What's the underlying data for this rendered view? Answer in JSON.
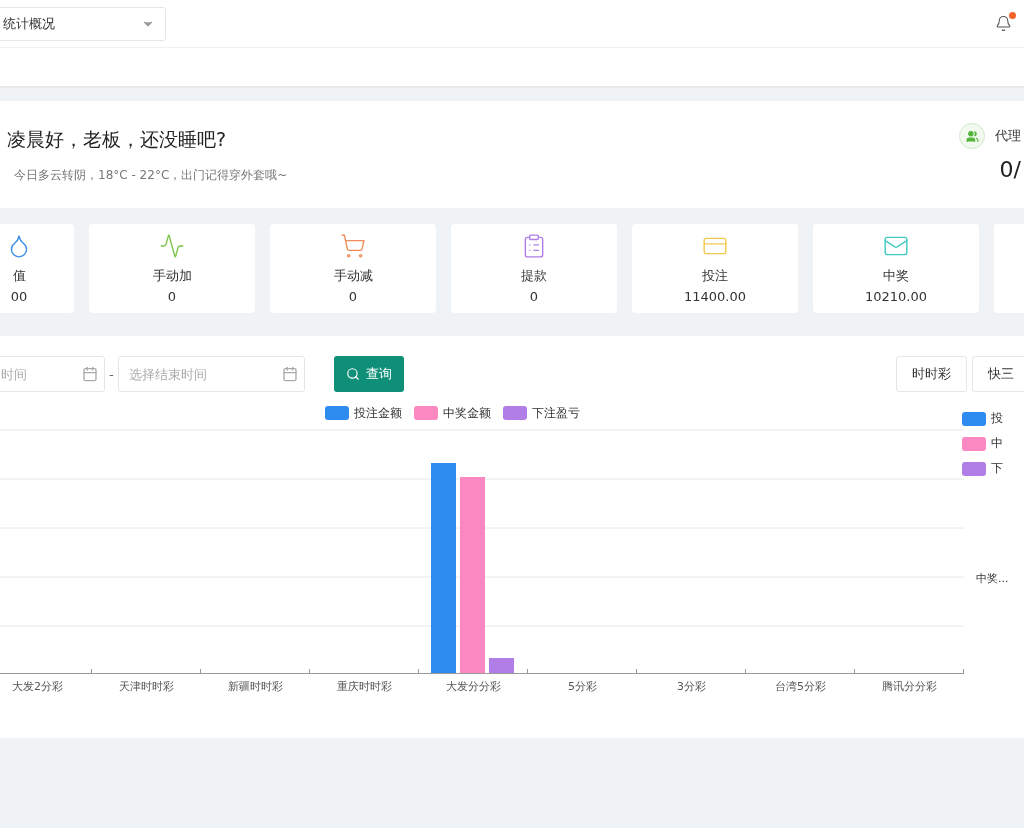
{
  "header": {
    "select": {
      "value": "统计概况"
    },
    "notification": {
      "unread": true
    }
  },
  "greeting": {
    "title": "凌晨好，老板，还没睡吧?",
    "subtitle": "今日多云转阴，18°C - 22°C，出门记得穿外套哦~",
    "agent_label": "代理",
    "agent_value": "0/"
  },
  "stats": [
    {
      "kind": "drop",
      "label": "值",
      "value": "00"
    },
    {
      "kind": "pulse",
      "label": "手动加",
      "value": "0"
    },
    {
      "kind": "cart",
      "label": "手动减",
      "value": "0"
    },
    {
      "kind": "clipboard",
      "label": "提款",
      "value": "0"
    },
    {
      "kind": "card",
      "label": "投注",
      "value": "11400.00"
    },
    {
      "kind": "mail",
      "label": "中奖",
      "value": "10210.00"
    },
    {
      "kind": "empty"
    }
  ],
  "filter": {
    "start": {
      "placeholder": "时间"
    },
    "separator": "-",
    "end": {
      "placeholder": "选择结束时间"
    },
    "query_button": "查询"
  },
  "game_tabs": [
    "时时彩",
    "快三"
  ],
  "chart": {
    "legend": [
      {
        "label": "投注金额",
        "color": "#2e8bef"
      },
      {
        "label": "中奖金额",
        "color": "#fb88c1"
      },
      {
        "label": "下注盈亏",
        "color": "#b07ee6"
      }
    ],
    "categories": [
      "大发2分彩",
      "天津时时彩",
      "新疆时时彩",
      "重庆时时彩",
      "大发分分彩",
      "5分彩",
      "3分彩",
      "台湾5分彩",
      "腾讯分分彩"
    ],
    "side_legend": [
      {
        "label": "投",
        "color": "#2e8bef"
      },
      {
        "label": "中",
        "color": "#fb88c1"
      },
      {
        "label": "下",
        "color": "#b07ee6"
      }
    ],
    "side_note": "中奖..."
  }
}
